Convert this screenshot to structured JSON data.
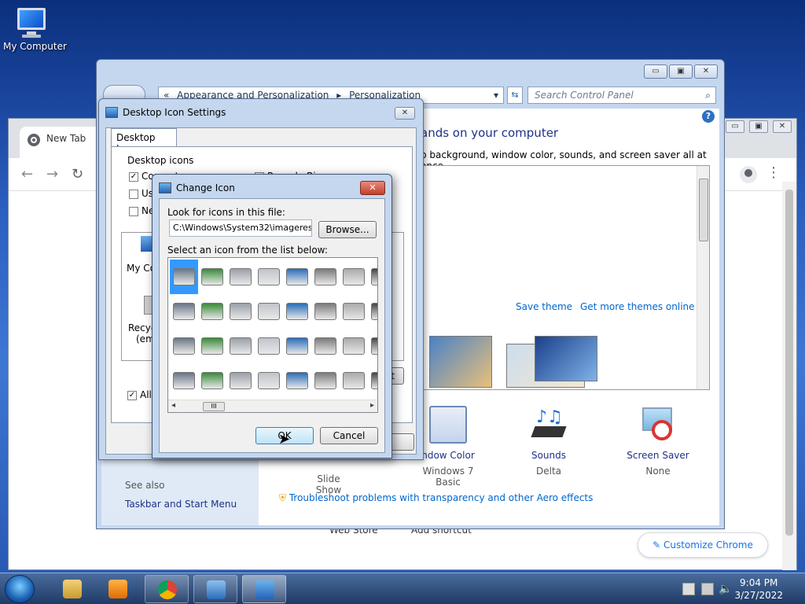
{
  "desktop": {
    "icon_label": "My Computer"
  },
  "chrome": {
    "tab_label": "New Tab",
    "web_store": "Web Store",
    "add_shortcut": "Add shortcut",
    "customize": "Customize Chrome"
  },
  "control_panel": {
    "breadcrumb": [
      "Appearance and Personalization",
      "Personalization"
    ],
    "breadcrumb_sep": "«",
    "search_placeholder": "Search Control Panel",
    "heading": "...ands on your computer",
    "heading_visible": "ands on your computer",
    "subtext": "p background, window color, sounds, and screen saver all at once.",
    "save_theme": "Save theme",
    "get_more_themes": "Get more themes online",
    "bottom_items": [
      {
        "title": "Slide Show",
        "subtitle": "Slide Show"
      },
      {
        "title": "ndow Color",
        "subtitle": "Windows 7 Basic"
      },
      {
        "title": "Sounds",
        "subtitle": "Delta"
      },
      {
        "title": "Screen Saver",
        "subtitle": "None"
      }
    ],
    "see_also": "See also",
    "taskbar_link": "Taskbar and Start Menu",
    "troubleshoot": "Troubleshoot problems with transparency and other Aero effects"
  },
  "desktop_icon_settings": {
    "title": "Desktop Icon Settings",
    "tab": "Desktop Icons",
    "group_label": "Desktop icons",
    "checkboxes": [
      {
        "label": "Computer",
        "checked": true
      },
      {
        "label": "Recycle Bin",
        "checked": true
      },
      {
        "label": "Use",
        "checked": false
      },
      {
        "label": "Ne",
        "checked": false
      }
    ],
    "preview_labels": [
      "My Co",
      "Recyc",
      "(emp"
    ],
    "allow_label": "Allow",
    "allow_checked": true,
    "partial_button": "lt"
  },
  "change_icon": {
    "title": "Change Icon",
    "look_label": "Look for icons in this file:",
    "path_value": "C:\\Windows\\System32\\imageres.dll",
    "browse": "Browse...",
    "select_label": "Select an icon from the list below:",
    "ok": "OK",
    "cancel": "Cancel",
    "scroll_thumb": "III"
  },
  "taskbar": {
    "time": "9:04 PM",
    "date": "3/27/2022"
  },
  "colors": {
    "link": "#0066cc",
    "heading": "#1e3287",
    "selection": "#3399ff"
  }
}
